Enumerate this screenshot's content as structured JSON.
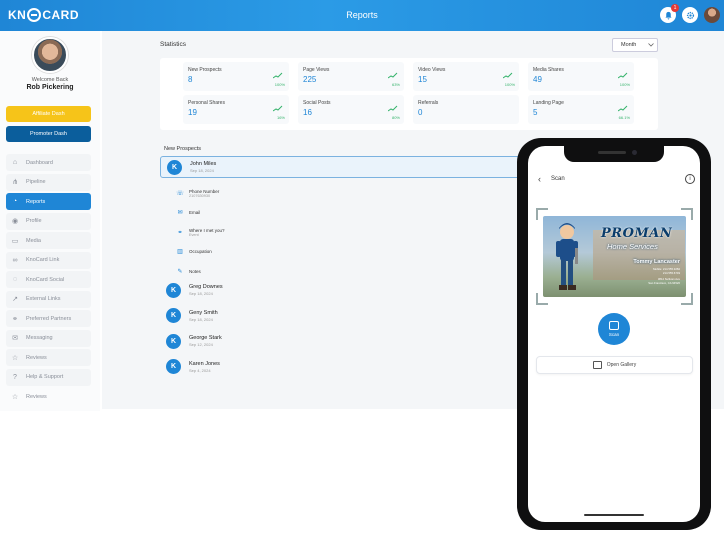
{
  "header": {
    "logo_text": "KN",
    "logo_text2": "CARD",
    "title": "Reports",
    "notification_count": "1"
  },
  "sidebar": {
    "welcome": "Welcome Back",
    "user_name": "Rob Pickering",
    "affiliate_label": "Affiliate Dash",
    "promoter_label": "Promoter Dash",
    "items": [
      {
        "label": "Dashboard",
        "icon": "home-icon"
      },
      {
        "label": "Pipeline",
        "icon": "pipeline-icon"
      },
      {
        "label": "Reports",
        "icon": "reports-icon"
      },
      {
        "label": "Profile",
        "icon": "profile-icon"
      },
      {
        "label": "Media",
        "icon": "media-icon"
      },
      {
        "label": "KnoCard Link",
        "icon": "link-icon"
      },
      {
        "label": "KnoCard Social",
        "icon": "social-icon"
      },
      {
        "label": "External Links",
        "icon": "external-link-icon"
      },
      {
        "label": "Preferred Partners",
        "icon": "partners-icon"
      },
      {
        "label": "Messaging",
        "icon": "message-icon"
      },
      {
        "label": "Reviews",
        "icon": "star-icon"
      },
      {
        "label": "Help & Support",
        "icon": "help-icon"
      },
      {
        "label": "Reviews",
        "icon": "star-icon"
      }
    ]
  },
  "stats": {
    "title": "Statistics",
    "period": "Month",
    "cards": [
      {
        "label": "New Prospects",
        "value": "8",
        "pct": "100%"
      },
      {
        "label": "Page Views",
        "value": "225",
        "pct": "63%"
      },
      {
        "label": "Video Views",
        "value": "15",
        "pct": "100%"
      },
      {
        "label": "Media Shares",
        "value": "49",
        "pct": "100%"
      },
      {
        "label": "Personal Shares",
        "value": "19",
        "pct": "16%"
      },
      {
        "label": "Social Posts",
        "value": "16",
        "pct": "80%"
      },
      {
        "label": "Referrals",
        "value": "0",
        "pct": ""
      },
      {
        "label": "Landing Page",
        "value": "5",
        "pct": "66.1%"
      }
    ]
  },
  "prospects": {
    "title": "New Prospects",
    "selected": {
      "name": "John Miles",
      "date": "Sep 18, 2024"
    },
    "details": [
      {
        "label": "Phone Number",
        "value": "2107630930",
        "icon": "phone-icon"
      },
      {
        "label": "Email",
        "value": "",
        "icon": "mail-icon"
      },
      {
        "label": "Where I met you?",
        "value": "Event",
        "icon": "handshake-icon"
      },
      {
        "label": "Occupation",
        "value": "",
        "icon": "building-icon"
      },
      {
        "label": "Notes",
        "value": "",
        "icon": "pencil-icon"
      }
    ],
    "rows": [
      {
        "name": "Greg Downes",
        "date": "Sep 18, 2024"
      },
      {
        "name": "Geny Smith",
        "date": "Sep 18, 2024"
      },
      {
        "name": "George Stark",
        "date": "Sep 12, 2024"
      },
      {
        "name": "Karen Jones",
        "date": "Sep 4, 2024"
      }
    ]
  },
  "phone": {
    "screen_title": "Scan",
    "card": {
      "brand": "PROMAN",
      "sub": "Home Services",
      "person": "Tommy Lancaster",
      "line1": "Mobile: 214.555.3282",
      "line2": "214.555.6749",
      "line3": "3812 Sullivan Ave",
      "line4": "San Francisco, CA 94520"
    },
    "scan_label": "Scan",
    "gallery_label": "Open Gallery"
  },
  "colors": {
    "brand_blue": "#1f86d6",
    "affiliate_yellow": "#f6c419",
    "promoter_navy": "#0b5e9c",
    "trend_green": "#35b36b"
  }
}
